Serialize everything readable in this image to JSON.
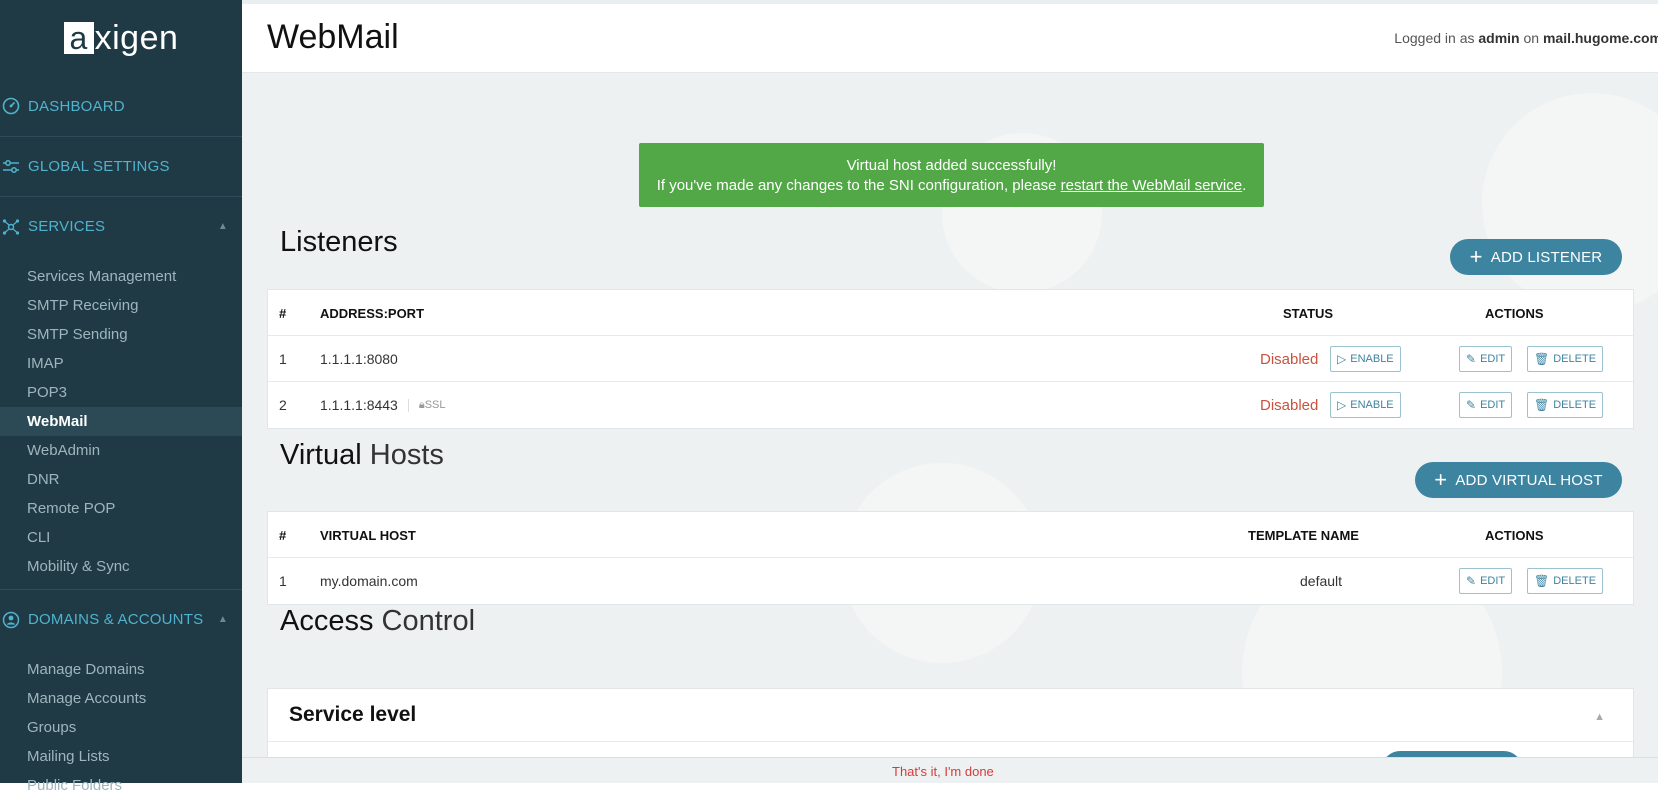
{
  "app": {
    "logo_text": "xigen",
    "logo_initial": "a"
  },
  "sidebar": {
    "sections": [
      {
        "label": "DASHBOARD",
        "icon": "dashboard-icon"
      },
      {
        "label": "GLOBAL SETTINGS",
        "icon": "sliders-icon"
      },
      {
        "label": "SERVICES",
        "icon": "network-icon"
      },
      {
        "label": "DOMAINS & ACCOUNTS",
        "icon": "user-circle-icon"
      }
    ],
    "services_items": [
      "Services Management",
      "SMTP Receiving",
      "SMTP Sending",
      "IMAP",
      "POP3",
      "WebMail",
      "WebAdmin",
      "DNR",
      "Remote POP",
      "CLI",
      "Mobility & Sync"
    ],
    "domains_items": [
      "Manage Domains",
      "Manage Accounts",
      "Groups",
      "Mailing Lists",
      "Public Folders"
    ],
    "active_item": "WebMail"
  },
  "header": {
    "title": "WebMail",
    "login_prefix": "Logged in as",
    "login_user": "admin",
    "login_on": "on",
    "login_host": "mail.hugome.com"
  },
  "alert": {
    "line1": "Virtual host added successfully!",
    "line2_prefix": "If you've made any changes to the SNI configuration, please",
    "link_text": "restart the WebMail service",
    "line2_suffix": "."
  },
  "listeners": {
    "title": "Listeners",
    "add_button": "ADD LISTENER",
    "headers": {
      "num": "#",
      "address": "ADDRESS:PORT",
      "status": "STATUS",
      "actions": "ACTIONS"
    },
    "rows": [
      {
        "num": "1",
        "address": "1.1.1.1:8080",
        "ssl": "",
        "status": "Disabled",
        "toggle": "ENABLE",
        "edit": "EDIT",
        "delete": "DELETE"
      },
      {
        "num": "2",
        "address": "1.1.1.1:8443",
        "ssl": "SSL",
        "status": "Disabled",
        "toggle": "ENABLE",
        "edit": "EDIT",
        "delete": "DELETE"
      }
    ]
  },
  "virtual_hosts": {
    "title_strong": "Virtual",
    "title_light": "Hosts",
    "add_button": "ADD VIRTUAL HOST",
    "headers": {
      "num": "#",
      "host": "VIRTUAL HOST",
      "template": "TEMPLATE NAME",
      "actions": "ACTIONS"
    },
    "rows": [
      {
        "num": "1",
        "host": "my.domain.com",
        "template": "default",
        "edit": "EDIT",
        "delete": "DELETE"
      }
    ]
  },
  "access_control": {
    "title_strong": "Access",
    "title_light": "Control",
    "service_level": "Service level"
  },
  "footer": {
    "done_text": "That's it, I'm done"
  },
  "colors": {
    "sidebar_bg": "#1f3a44",
    "accent": "#3d84a0",
    "success": "#52a846",
    "disabled": "#c9523f"
  }
}
